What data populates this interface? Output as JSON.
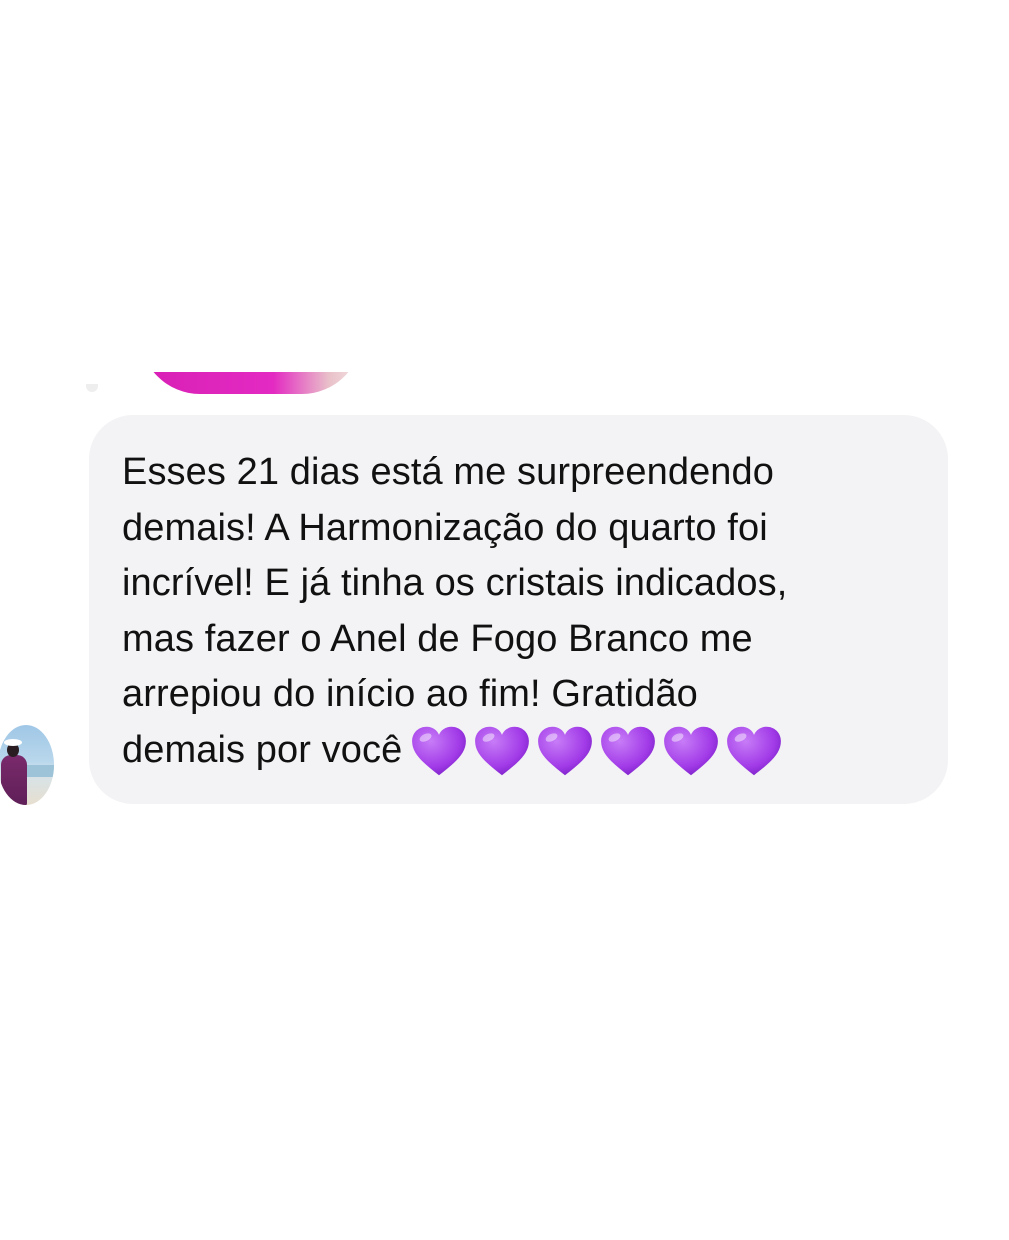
{
  "thread": {
    "previous_message": {
      "type": "image",
      "accent_color": "#d81fb5"
    },
    "message": {
      "text": "Esses 21 dias está me surpreendendo\ndemais! A Harmonização do quarto foi\nincrível! E já tinha os cristais indicados,\nmas fazer o Anel de Fogo Branco me\narrepiou do início ao fim! Gratidão\ndemais por você",
      "emoji": "💜💜💜💜💜💜",
      "emoji_count": 6,
      "emoji_icon": "purple-heart-icon",
      "bubble_color": "#f3f3f5",
      "heart_color": "#a23be8"
    },
    "sender": {
      "avatar_icon": "avatar-photo"
    }
  }
}
